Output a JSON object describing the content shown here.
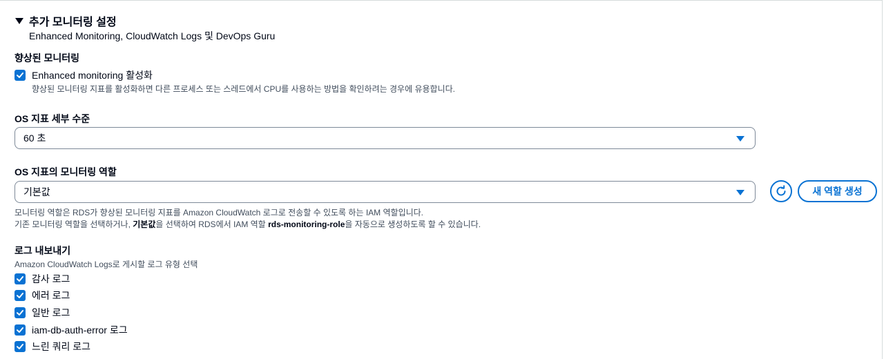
{
  "section": {
    "title": "추가 모니터링 설정",
    "description": "Enhanced Monitoring, CloudWatch Logs 및 DevOps Guru",
    "caret_icon": "caret-down-icon"
  },
  "enhanced_monitoring": {
    "label": "향상된 모니터링",
    "checkbox_label": "Enhanced monitoring 활성화",
    "checked": true,
    "help": "향상된 모니터링 지표를 활성화하면 다른 프로세스 또는 스레드에서 CPU를 사용하는 방법을 확인하려는 경우에 유용합니다."
  },
  "granularity": {
    "label": "OS 지표 세부 수준",
    "value": "60 초"
  },
  "monitoring_role": {
    "label": "OS 지표의 모니터링 역할",
    "value": "기본값",
    "refresh_icon": "refresh-icon",
    "create_button": "새 역할 생성",
    "desc_line1": "모니터링 역할은 RDS가 향상된 모니터링 지표를 Amazon CloudWatch 로그로 전송할 수 있도록 하는 IAM 역할입니다.",
    "desc_line2_part1": "기존 모니터링 역할을 선택하거나, ",
    "desc_line2_bold1": "기본값",
    "desc_line2_part2": "을 선택하여 RDS에서 IAM 역할 ",
    "desc_line2_bold2": "rds-monitoring-role",
    "desc_line2_part3": "을 자동으로 생성하도록 할 수 있습니다."
  },
  "log_exports": {
    "label": "로그 내보내기",
    "description": "Amazon CloudWatch Logs로 게시할 로그 유형 선택",
    "items": [
      {
        "label": "감사 로그",
        "checked": true
      },
      {
        "label": "에러 로그",
        "checked": true
      },
      {
        "label": "일반 로그",
        "checked": true
      },
      {
        "label": "iam-db-auth-error 로그",
        "checked": true
      },
      {
        "label": "느린 쿼리 로그",
        "checked": true
      }
    ]
  },
  "colors": {
    "accent": "#0972d3",
    "text": "#000716",
    "secondary_text": "#414d5c",
    "border": "#7d8998"
  }
}
